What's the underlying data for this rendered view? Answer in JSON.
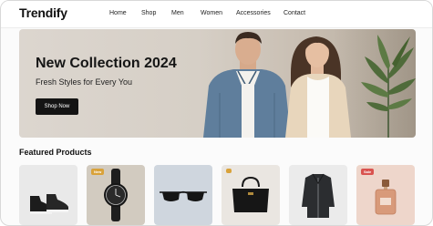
{
  "app": {
    "name": "Trendify"
  },
  "nav": {
    "links": [
      {
        "label": "Home"
      },
      {
        "label": "Shop"
      },
      {
        "label": "Men"
      },
      {
        "label": "Women"
      },
      {
        "label": "Accessories"
      },
      {
        "label": "Contact"
      }
    ],
    "icons": [
      "search-icon",
      "bag-icon",
      "user-icon"
    ]
  },
  "hero": {
    "title": "New Collection 2024",
    "subtitle": "Fresh Styles for Every You",
    "cta_label": "Shop Now"
  },
  "featured": {
    "title": "Featured Products",
    "products": [
      {
        "kind": "sneakers"
      },
      {
        "kind": "watch",
        "badge": "New"
      },
      {
        "kind": "sunglasses"
      },
      {
        "kind": "handbag",
        "badge": ""
      },
      {
        "kind": "jacket"
      },
      {
        "kind": "perfume",
        "badge": "Sale"
      }
    ]
  },
  "colors": {
    "accent": "#141414",
    "badge_new": "#d9a23a",
    "badge_sale": "#d9534f"
  }
}
